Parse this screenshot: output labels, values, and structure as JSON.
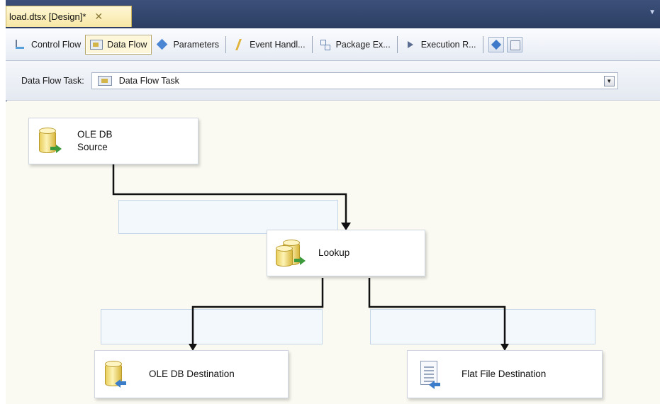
{
  "document_tab": {
    "title": "load.dtsx [Design]*",
    "close_glyph": "✕"
  },
  "designer_tabs": [
    {
      "label": "Control Flow",
      "icon": "control-flow-icon"
    },
    {
      "label": "Data Flow",
      "icon": "data-flow-icon",
      "active": true
    },
    {
      "label": "Parameters",
      "icon": "parameters-icon"
    },
    {
      "label": "Event Handl...",
      "icon": "event-handlers-icon"
    },
    {
      "label": "Package Ex...",
      "icon": "package-explorer-icon"
    },
    {
      "label": "Execution R...",
      "icon": "execution-results-icon"
    }
  ],
  "task_bar": {
    "label": "Data Flow Task:",
    "selected": "Data Flow Task",
    "dropdown_glyph": "▼"
  },
  "components": {
    "source": {
      "label": "OLE DB Source",
      "icon": "ole-db-source-icon"
    },
    "lookup": {
      "label": "Lookup",
      "icon": "lookup-icon"
    },
    "ole_destination": {
      "label": "OLE DB Destination",
      "icon": "ole-db-destination-icon"
    },
    "flat_destination": {
      "label": "Flat File Destination",
      "icon": "flat-file-destination-icon"
    }
  },
  "colors": {
    "title_bar": "#2c3e62",
    "active_tab": "#fdf6d8",
    "canvas": "#fbfaf2",
    "path_label_fill": "#f3f8fd",
    "connector": "#111111"
  }
}
